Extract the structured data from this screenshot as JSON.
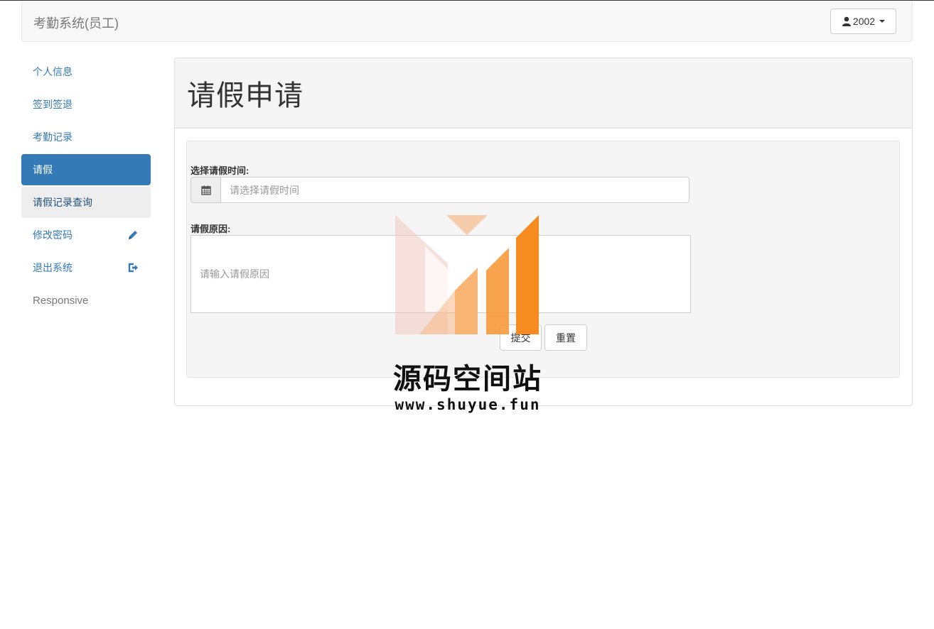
{
  "navbar": {
    "brand": "考勤系统(员工)",
    "user_label": "2002"
  },
  "sidebar": {
    "items": [
      {
        "label": "个人信息"
      },
      {
        "label": "签到签退"
      },
      {
        "label": "考勤记录"
      },
      {
        "label": "请假"
      },
      {
        "label": "请假记录查询"
      },
      {
        "label": "修改密码",
        "icon": "pencil-icon"
      },
      {
        "label": "退出系统",
        "icon": "log-out-icon"
      },
      {
        "label": "Responsive"
      }
    ]
  },
  "main": {
    "title": "请假申请",
    "form": {
      "date_label": "选择请假时间:",
      "date_placeholder": "请选择请假时间",
      "reason_label": "请假原因:",
      "reason_placeholder": "请输入请假原因",
      "submit_label": "提交",
      "reset_label": "重置"
    }
  },
  "watermark": {
    "title": "源码空间站",
    "url": "www.shuyue.fun"
  },
  "colors": {
    "primary": "#337ab7",
    "watermark_orange": "#f68b1f"
  }
}
